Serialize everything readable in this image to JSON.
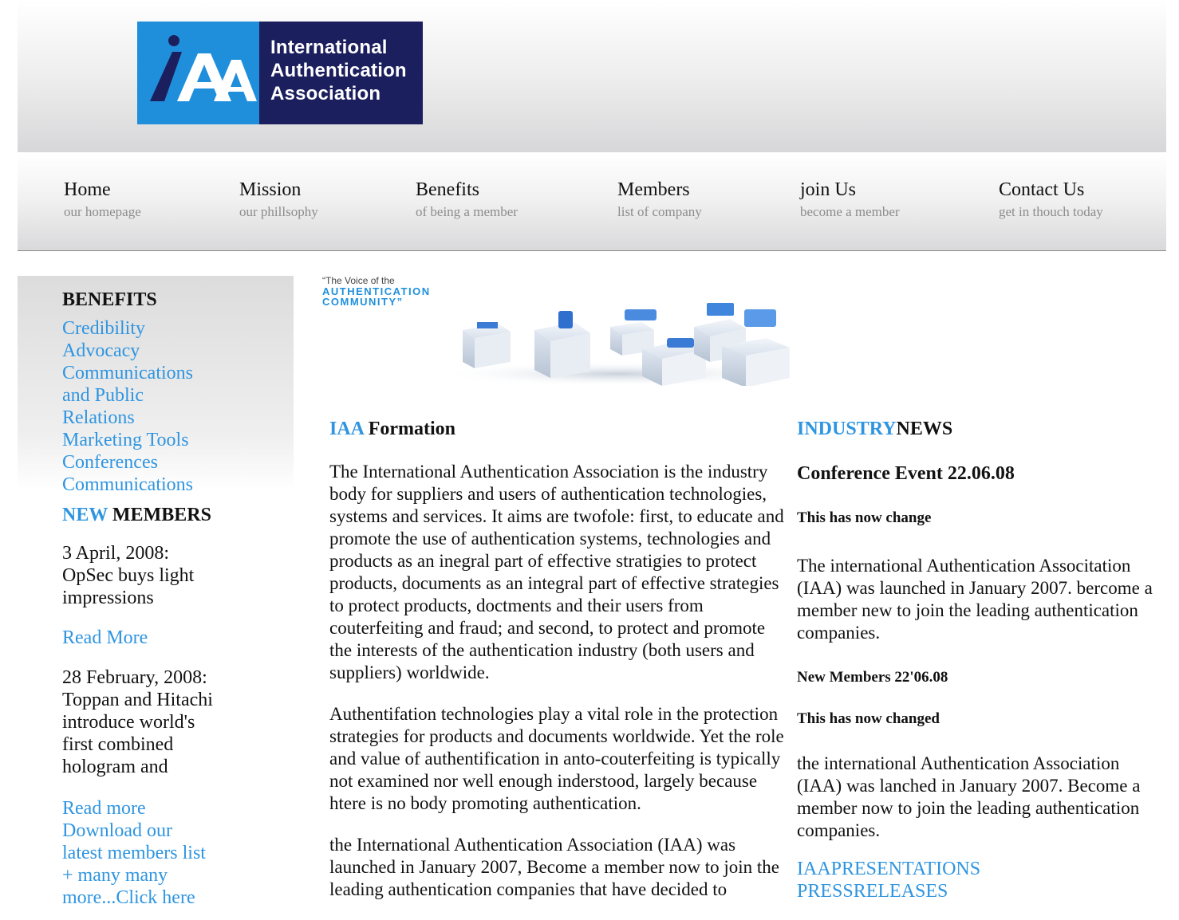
{
  "logo": {
    "mark_text": "iAA",
    "lines": [
      "International",
      "Authentication",
      "Association"
    ]
  },
  "nav": [
    {
      "title": "Home",
      "sub": "our homepage"
    },
    {
      "title": "Mission",
      "sub": "our phillsophy"
    },
    {
      "title": "Benefits",
      "sub": "of being a member"
    },
    {
      "title": "Members",
      "sub": "list of company"
    },
    {
      "title": "join Us",
      "sub": "become a member"
    },
    {
      "title": "Contact Us",
      "sub": "get in thouch today"
    }
  ],
  "sidebar": {
    "benefits_heading": "BENEFITS",
    "benefits_links": [
      "Credibility",
      "Advocacy",
      "Communications",
      "and Public",
      "Relations",
      "Marketing Tools",
      "Conferences",
      "Communications"
    ],
    "new_members_heading_accent": "NEW",
    "new_members_heading_rest": " MEMBERS",
    "news1": "3 April, 2008: OpSec buys light impressions",
    "read_more_1": "Read More",
    "news2": "28 February, 2008: Toppan and Hitachi introduce world's first combined hologram and",
    "read_more_2": "Read more",
    "download_links": [
      "Download our",
      "latest members list",
      "+ many many",
      "more...Click here"
    ]
  },
  "banner": {
    "tag_line1": "“The Voice of the",
    "tag_line2": "AUTHENTICATION",
    "tag_line3": "COMMUNITY”"
  },
  "main": {
    "title_accent": "IAA",
    "title_rest": " Formation",
    "p1": "The International Authentication Association is the industry body for suppliers and users of authentication technologies, systems and services. It aims are twofole: first, to educate and promote the use of authentication systems, technologies and products as an inegral part of effective stratigies to protect products, documents as an integral part of effective strategies to protect products, doctments and their users from couterfeiting and fraud; and second, to protect and promote the interests of the authentication industry (both users and suppliers) worldwide.",
    "p2": "Authentifation technologies play a vital role in the protection strategies for products and documents worldwide. Yet the role and value of authentification in anto-couterfeiting is typically not examined nor well enough inderstood, largely because htere is no body promoting authentication.",
    "p3": "the International Authentication Association (IAA) was launched in January 2007, Become a member now to join the leading authentication companies that have decided to"
  },
  "right": {
    "title_accent": "INDUSTRY",
    "title_rest": "NEWS",
    "event_title": "Conference Event 22.06.08",
    "event_note": "This has now change",
    "event_body": "The international Authentication Associtation (IAA) was launched in January 2007. bercome a member new to join the leading authentication companies.",
    "members_title": "New Members 22'06.08",
    "members_note": "This has now changed",
    "members_body": "the international Authentication Association (IAA) was lanched in January 2007. Become a member now to join the leading authentication companies.",
    "presentations_link": "IAAPRESENTATIONS",
    "press_link": "PRESSRELEASES"
  }
}
